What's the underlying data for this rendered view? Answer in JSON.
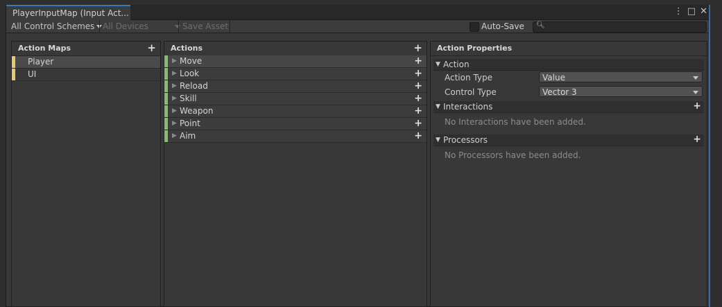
{
  "window": {
    "tab_title": "PlayerInputMap (Input Act...",
    "controls": [
      "⋮",
      "□",
      "✕"
    ]
  },
  "toolbar": {
    "control_schemes": "All Control Schemes",
    "devices": "All Devices",
    "save_asset": "Save Asset",
    "auto_save_label": "Auto-Save",
    "auto_save_checked": false,
    "search_value": ""
  },
  "action_maps": {
    "header": "Action Maps",
    "items": [
      {
        "label": "Player",
        "selected": true
      },
      {
        "label": "UI",
        "selected": false
      }
    ]
  },
  "actions": {
    "header": "Actions",
    "items": [
      {
        "label": "Move",
        "selected": true
      },
      {
        "label": "Look"
      },
      {
        "label": "Reload"
      },
      {
        "label": "Skill"
      },
      {
        "label": "Weapon"
      },
      {
        "label": "Point"
      },
      {
        "label": "Aim"
      }
    ]
  },
  "properties": {
    "header": "Action Properties",
    "action_section": "Action",
    "action_type_label": "Action Type",
    "action_type_value": "Value",
    "control_type_label": "Control Type",
    "control_type_value": "Vector 3",
    "interactions_section": "Interactions",
    "interactions_empty": "No Interactions have been added.",
    "processors_section": "Processors",
    "processors_empty": "No Processors have been added."
  },
  "colors": {
    "action_map_bar": "#e8c96a",
    "action_bar": "#85bd6e",
    "tab_accent": "#3a79bb"
  }
}
